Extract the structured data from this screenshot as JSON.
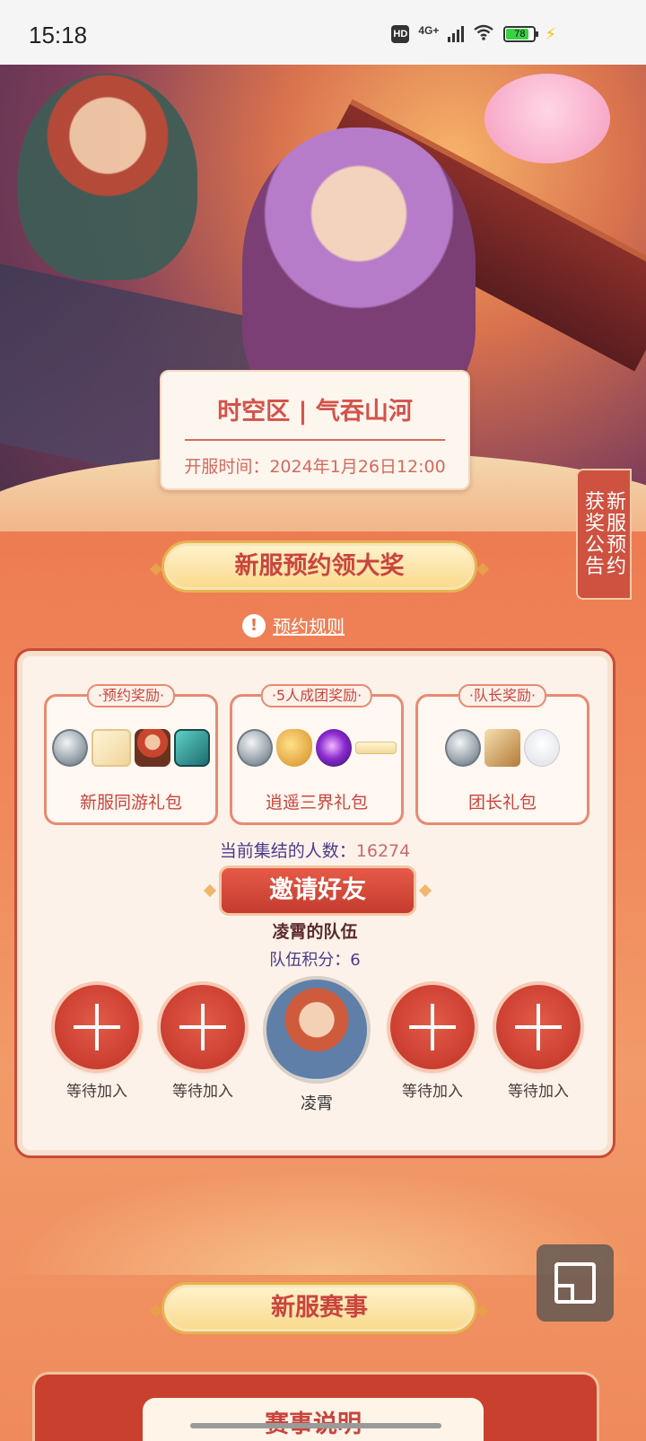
{
  "status_bar": {
    "time": "15:18",
    "hd": "HD",
    "network": "4G+",
    "battery": "78"
  },
  "server": {
    "name": "时空区 | 气吞山河",
    "open_time": "开服时间：2024年1月26日12:00"
  },
  "side_tab": {
    "col1": "获奖公告",
    "col2": "新服预约"
  },
  "section1": {
    "title": "新服预约领大奖",
    "rules_icon": "!",
    "rules": "预约规则"
  },
  "rewards": [
    {
      "tag": "·预约奖励·",
      "label": "新服同游礼包"
    },
    {
      "tag": "·5人成团奖励·",
      "label": "逍遥三界礼包"
    },
    {
      "tag": "·队长奖励·",
      "label": "团长礼包"
    }
  ],
  "gathering": {
    "prefix": "当前集结的人数：",
    "count": "16274"
  },
  "invite_label": "邀请好友",
  "team": {
    "name": "凌霄的队伍",
    "score": "队伍积分：6"
  },
  "slots": {
    "waiting": "等待加入",
    "leader_name": "凌霄"
  },
  "section2": {
    "title": "新服赛事",
    "panel_title": "赛事说明"
  }
}
